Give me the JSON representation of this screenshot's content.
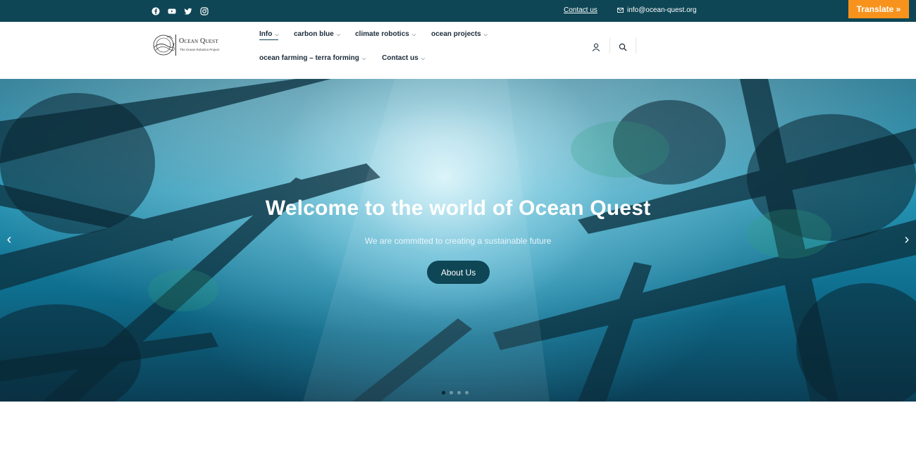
{
  "topbar": {
    "social": [
      {
        "icon": "facebook-icon"
      },
      {
        "icon": "youtube-icon"
      },
      {
        "icon": "twitter-icon"
      },
      {
        "icon": "instagram-icon"
      }
    ],
    "contact_link": "Contact us",
    "email": "info@ocean-quest.org",
    "translate_label": "Translate »",
    "colors": {
      "bar": "#0e4655",
      "translate": "#f7931d"
    }
  },
  "header": {
    "logo": {
      "title": "Ocean Quest",
      "subtitle": "The Ocean Robotics Project"
    },
    "nav": [
      {
        "label": "Info",
        "active": true
      },
      {
        "label": "carbon blue"
      },
      {
        "label": "climate robotics"
      },
      {
        "label": "ocean projects"
      },
      {
        "label": "ocean farming – terra forming"
      },
      {
        "label": "Contact us"
      }
    ],
    "icons": [
      "user-icon",
      "search-icon"
    ]
  },
  "hero": {
    "title": "Welcome to the world of Ocean Quest",
    "subtitle": "We are committed to creating a sustainable future",
    "button_label": "About Us",
    "arrows": {
      "prev": "‹",
      "next": "›"
    },
    "slide_count": 4,
    "active_slide": 1,
    "colors": {
      "button": "#0e4655"
    }
  }
}
